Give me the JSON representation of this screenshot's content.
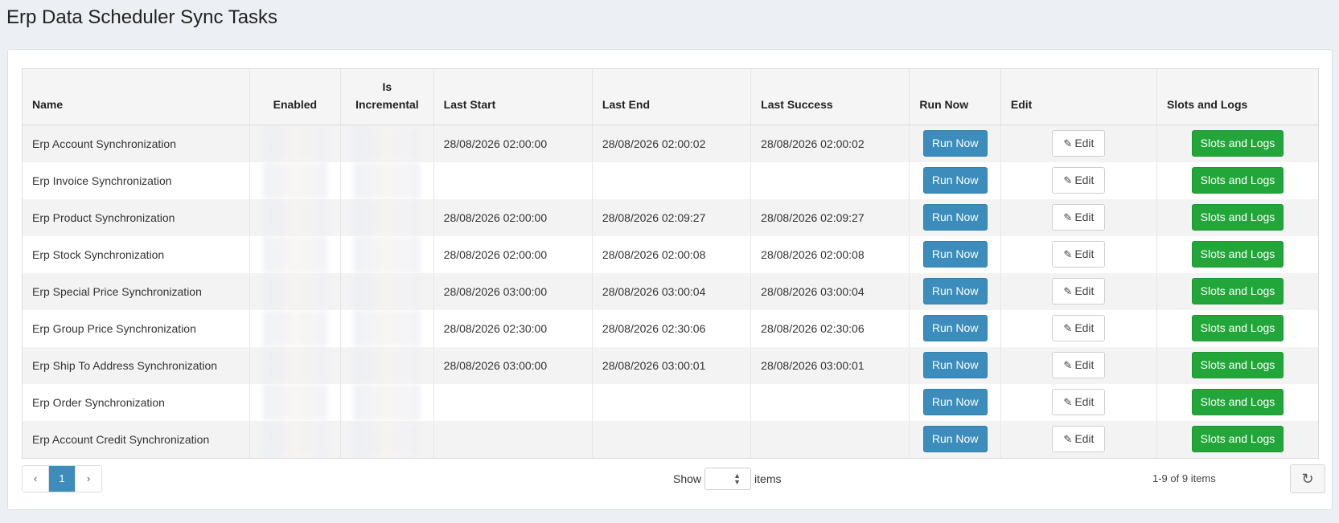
{
  "page": {
    "title": "Erp Data Scheduler Sync Tasks"
  },
  "columns": {
    "name": "Name",
    "enabled": "Enabled",
    "is_incremental_1": "Is",
    "is_incremental_2": "Incremental",
    "last_start": "Last Start",
    "last_end": "Last End",
    "last_success": "Last Success",
    "run_now": "Run Now",
    "edit": "Edit",
    "slots_and_logs": "Slots and Logs"
  },
  "rows": [
    {
      "name": "Erp Account Synchronization",
      "last_start": "28/08/2026 02:00:00",
      "last_end": "28/08/2026 02:00:02",
      "last_success": "28/08/2026 02:00:02"
    },
    {
      "name": "Erp Invoice Synchronization",
      "last_start": "",
      "last_end": "",
      "last_success": ""
    },
    {
      "name": "Erp Product Synchronization",
      "last_start": "28/08/2026 02:00:00",
      "last_end": "28/08/2026 02:09:27",
      "last_success": "28/08/2026 02:09:27"
    },
    {
      "name": "Erp Stock Synchronization",
      "last_start": "28/08/2026 02:00:00",
      "last_end": "28/08/2026 02:00:08",
      "last_success": "28/08/2026 02:00:08"
    },
    {
      "name": "Erp Special Price Synchronization",
      "last_start": "28/08/2026 03:00:00",
      "last_end": "28/08/2026 03:00:04",
      "last_success": "28/08/2026 03:00:04"
    },
    {
      "name": "Erp Group Price Synchronization",
      "last_start": "28/08/2026 02:30:00",
      "last_end": "28/08/2026 02:30:06",
      "last_success": "28/08/2026 02:30:06"
    },
    {
      "name": "Erp Ship To Address Synchronization",
      "last_start": "28/08/2026 03:00:00",
      "last_end": "28/08/2026 03:00:01",
      "last_success": "28/08/2026 03:00:01"
    },
    {
      "name": "Erp Order Synchronization",
      "last_start": "",
      "last_end": "",
      "last_success": ""
    },
    {
      "name": "Erp Account Credit Synchronization",
      "last_start": "",
      "last_end": "",
      "last_success": ""
    }
  ],
  "buttons": {
    "run_now": "Run Now",
    "edit": "Edit",
    "slots_and_logs": "Slots and Logs"
  },
  "pager": {
    "prev_icon": "chevron-left-icon",
    "next_icon": "chevron-right-icon",
    "current_page": "1",
    "show_label": "Show",
    "items_label": "items",
    "page_size_value": "",
    "count_text": "1-9 of 9 items",
    "refresh_icon": "refresh-icon"
  },
  "colors": {
    "primary": "#3c8dbc",
    "success": "#22a63a",
    "background": "#ecf0f5"
  }
}
